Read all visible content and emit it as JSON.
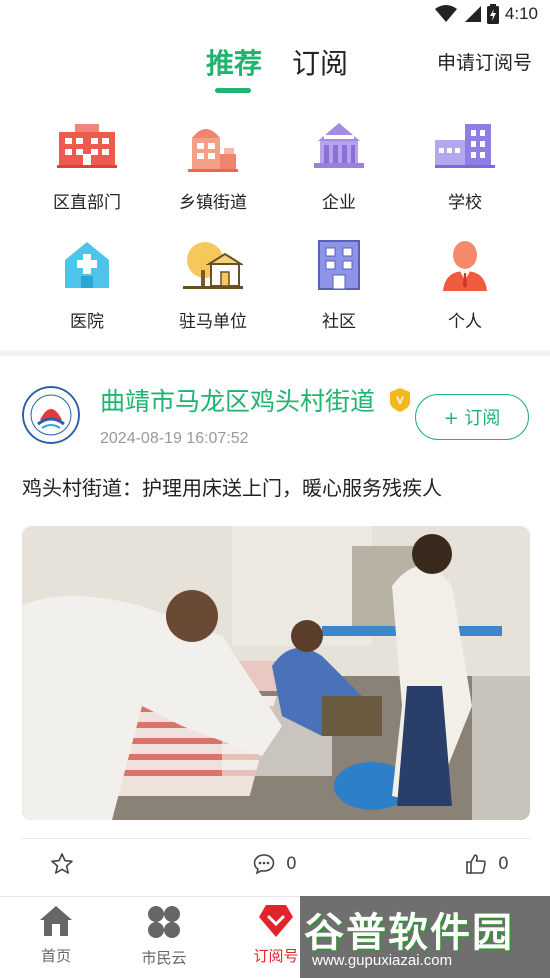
{
  "status_bar": {
    "time": "4:10",
    "icons": [
      "wifi-icon",
      "cellular-signal-icon",
      "battery-icon"
    ]
  },
  "top_nav": {
    "tabs": [
      {
        "label": "推荐",
        "active": true
      },
      {
        "label": "订阅",
        "active": false
      }
    ],
    "apply_link": "申请订阅号"
  },
  "categories": [
    {
      "label": "区直部门",
      "icon": "government-building-icon"
    },
    {
      "label": "乡镇街道",
      "icon": "street-building-icon"
    },
    {
      "label": "企业",
      "icon": "enterprise-icon"
    },
    {
      "label": "学校",
      "icon": "school-icon"
    },
    {
      "label": "医院",
      "icon": "hospital-icon"
    },
    {
      "label": "驻马单位",
      "icon": "resident-unit-icon"
    },
    {
      "label": "社区",
      "icon": "community-icon"
    },
    {
      "label": "个人",
      "icon": "person-icon"
    }
  ],
  "post": {
    "author": "曲靖市马龙区鸡头村街道",
    "verified_badge": "V",
    "time": "2024-08-19 16:07:52",
    "subscribe_label": "+ 订阅",
    "title": "鸡头村街道：护理用床送上门，暖心服务残疾人",
    "image_alt": "workers assembling a nursing bed in a home",
    "actions": {
      "comments": "0",
      "likes": "0"
    }
  },
  "bottom_nav": {
    "items": [
      {
        "label": "首页",
        "icon": "home-icon",
        "active": false
      },
      {
        "label": "市民云",
        "icon": "cloud-petals-icon",
        "active": false
      },
      {
        "label": "订阅号",
        "icon": "subscription-heart-icon",
        "active": true
      }
    ]
  },
  "watermark": {
    "title": "谷普软件园",
    "url": "www.gupuxiazai.com"
  },
  "colors": {
    "accent": "#1fb46f",
    "active_nav": "#e0242a"
  }
}
